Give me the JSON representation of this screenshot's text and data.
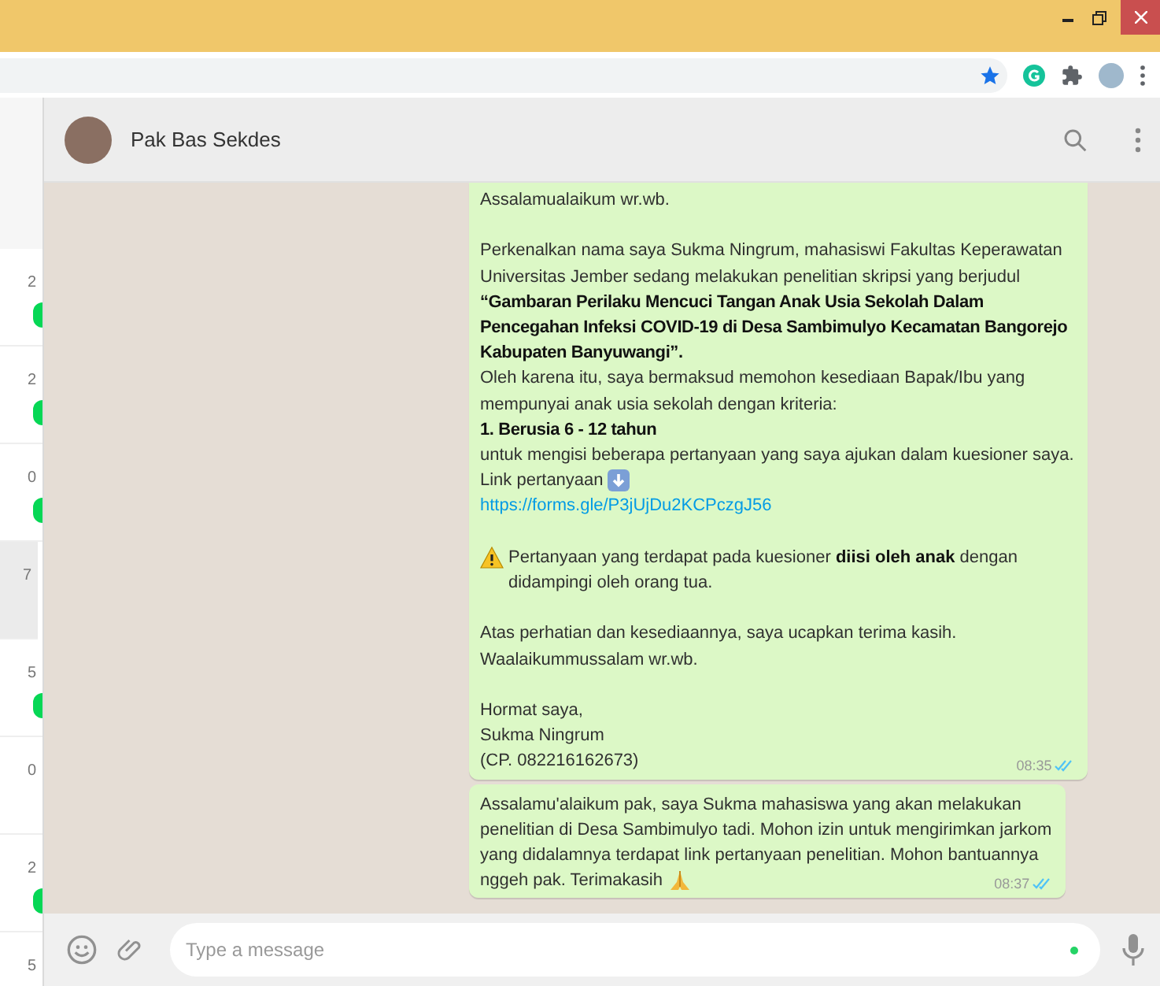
{
  "sidebar": {
    "items": [
      {
        "time": "2",
        "unread": true,
        "selected": false
      },
      {
        "time": "2",
        "unread": true,
        "selected": false
      },
      {
        "time": "0",
        "unread": true,
        "selected": false
      },
      {
        "time": "7",
        "unread": false,
        "selected": true
      },
      {
        "time": "5",
        "unread": true,
        "selected": false
      },
      {
        "time": "0",
        "unread": false,
        "selected": false
      },
      {
        "time": "2",
        "unread": true,
        "selected": false
      },
      {
        "time": "5",
        "selected": false
      }
    ]
  },
  "chat": {
    "contact": "Pak Bas Sekdes",
    "messages": [
      {
        "time": "08:35",
        "read": true,
        "paragraphs": [
          [
            {
              "kind": "text",
              "lines": [
                "Assalamualaikum wr.wb."
              ]
            }
          ],
          [
            {
              "kind": "text",
              "lines": [
                "Perkenalkan nama saya Sukma Ningrum, mahasiswi Fakultas Keperawatan",
                "Universitas Jember sedang melakukan penelitian skripsi yang berjudul"
              ]
            },
            {
              "kind": "bold",
              "lines": [
                "“Gambaran Perilaku Mencuci Tangan Anak Usia Sekolah Dalam",
                "Pencegahan Infeksi COVID-19 di Desa Sambimulyo Kecamatan Bangorejo",
                "Kabupaten Banyuwangi”."
              ]
            },
            {
              "kind": "text",
              "lines": [
                "Oleh karena itu, saya bermaksud memohon kesediaan Bapak/Ibu yang",
                "mempunyai anak usia sekolah dengan kriteria:"
              ]
            },
            {
              "kind": "bold",
              "lines": [
                "1. Berusia 6 - 12 tahun"
              ]
            },
            {
              "kind": "text",
              "lines": [
                "untuk mengisi beberapa pertanyaan yang saya ajukan dalam kuesioner saya."
              ]
            },
            {
              "kind": "arrow",
              "lines": [
                "Link pertanyaan"
              ]
            },
            {
              "kind": "link",
              "lines": [
                "https://forms.gle/P3jUjDu2KCPczgJ56"
              ]
            }
          ],
          [
            {
              "kind": "warning",
              "lines": [
                "Pertanyaan yang terdapat pada kuesioner **diisi oleh anak** dengan",
                "didampingi oleh orang tua."
              ]
            }
          ],
          [
            {
              "kind": "text",
              "lines": [
                "Atas perhatian dan kesediaannya, saya ucapkan terima kasih.",
                "Waalaikummussalam wr.wb."
              ]
            }
          ],
          [
            {
              "kind": "text",
              "lines": [
                "Hormat saya,",
                "Sukma Ningrum",
                "(CP. 082216162673)"
              ]
            }
          ]
        ]
      },
      {
        "time": "08:37",
        "read": true,
        "paragraphs": [
          [
            {
              "kind": "hands",
              "lines": [
                "Assalamu'alaikum pak, saya Sukma mahasiswa yang akan melakukan",
                "penelitian di Desa Sambimulyo tadi. Mohon izin untuk mengirimkan jarkom",
                "yang didalamnya terdapat link pertanyaan penelitian. Mohon bantuannya",
                "nggeh pak. Terimakasih"
              ]
            }
          ]
        ]
      }
    ],
    "composer": {
      "placeholder": "Type a message"
    }
  }
}
